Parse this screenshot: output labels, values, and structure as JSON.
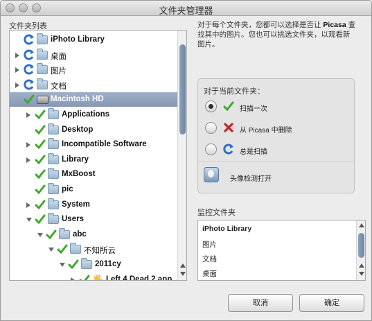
{
  "window": {
    "title": "文件夹管理器"
  },
  "sidebar": {
    "label": "文件夹列表"
  },
  "tree": [
    {
      "label": "iPhoto Library",
      "status": "always-scan-icon",
      "icon": "folder",
      "indent": 0,
      "arrow": "none",
      "bold": true
    },
    {
      "label": "桌面",
      "status": "always-scan-icon",
      "icon": "folder",
      "indent": 0,
      "arrow": "right",
      "bold": false
    },
    {
      "label": "图片",
      "status": "always-scan-icon",
      "icon": "folder",
      "indent": 0,
      "arrow": "right",
      "bold": false
    },
    {
      "label": "文档",
      "status": "always-scan-icon",
      "icon": "folder",
      "indent": 0,
      "arrow": "right",
      "bold": false
    },
    {
      "label": "Macintosh HD",
      "status": "scan-once-icon",
      "icon": "disk",
      "indent": 0,
      "arrow": "none",
      "bold": true,
      "selected": true
    },
    {
      "label": "Applications",
      "status": "scan-once-icon",
      "icon": "folder",
      "indent": 1,
      "arrow": "right",
      "bold": true
    },
    {
      "label": "Desktop",
      "status": "scan-once-icon",
      "icon": "folder",
      "indent": 1,
      "arrow": "none",
      "bold": true
    },
    {
      "label": "Incompatible Software",
      "status": "scan-once-icon",
      "icon": "folder",
      "indent": 1,
      "arrow": "right",
      "bold": true
    },
    {
      "label": "Library",
      "status": "scan-once-icon",
      "icon": "folder",
      "indent": 1,
      "arrow": "right",
      "bold": true
    },
    {
      "label": "MxBoost",
      "status": "scan-once-icon",
      "icon": "folder",
      "indent": 1,
      "arrow": "none",
      "bold": true
    },
    {
      "label": "pic",
      "status": "scan-once-icon",
      "icon": "folder",
      "indent": 1,
      "arrow": "none",
      "bold": true
    },
    {
      "label": "System",
      "status": "scan-once-icon",
      "icon": "folder",
      "indent": 1,
      "arrow": "right",
      "bold": true
    },
    {
      "label": "Users",
      "status": "scan-once-icon",
      "icon": "folder",
      "indent": 1,
      "arrow": "down",
      "bold": true
    },
    {
      "label": "abc",
      "status": "scan-once-icon",
      "icon": "folder",
      "indent": 2,
      "arrow": "down",
      "bold": true
    },
    {
      "label": "不知所云",
      "status": "scan-once-icon",
      "icon": "folder",
      "indent": 3,
      "arrow": "down",
      "bold": false
    },
    {
      "label": "2011cy",
      "status": "scan-once-icon",
      "icon": "folder",
      "indent": 4,
      "arrow": "down",
      "bold": true
    },
    {
      "label": "Left 4 Dead 2.app",
      "status": "scan-once-icon",
      "icon": "app",
      "indent": 5,
      "arrow": "right",
      "bold": true
    }
  ],
  "info": {
    "text1": "对于每个文件夹，您都可以选择是否让 ",
    "brand": "Picasa",
    "text2": " 查找其中的图片。您也可以挑选文件夹，以观看新图片。"
  },
  "options": {
    "heading": "对于当前文件夹：",
    "items": [
      {
        "label": "扫描一次",
        "icon": "scan-once-icon",
        "selected": true
      },
      {
        "label": "从 Picasa 中删除",
        "icon": "remove-icon",
        "selected": false
      },
      {
        "label": "总是扫描",
        "icon": "always-scan-icon",
        "selected": false
      }
    ],
    "face_label": "头像检测打开"
  },
  "watch": {
    "label": "监控文件夹",
    "items": [
      "iPhoto Library",
      "图片",
      "文档",
      "桌面"
    ]
  },
  "buttons": {
    "cancel": "取消",
    "ok": "确定"
  },
  "colors": {
    "selection": "#8f9fba",
    "check": "#3ea82a",
    "refresh": "#2f6fc2",
    "remove": "#c42525"
  }
}
